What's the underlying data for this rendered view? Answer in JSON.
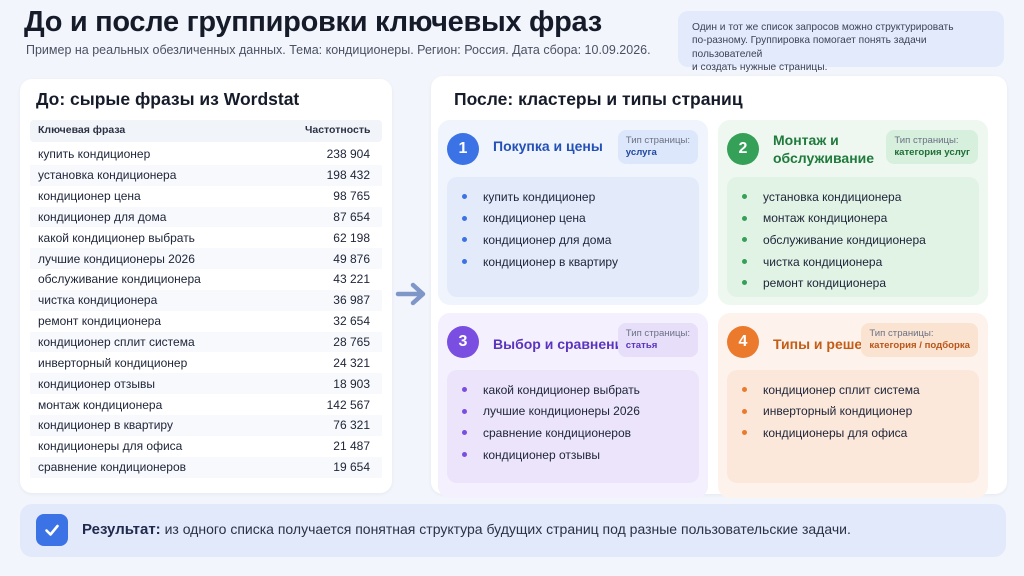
{
  "header": {
    "title": "До и после группировки ключевых фраз",
    "subtitle": "Пример на реальных обезличенных данных. Тема: кондиционеры. Регион: Россия. Дата сбора: 10.09.2026.",
    "note_lines": [
      "Один и тот же список запросов можно структурировать",
      "по-разному. Группировка помогает понять задачи пользователей",
      "и создать нужные страницы."
    ]
  },
  "before": {
    "title": "До: сырые фразы из Wordstat",
    "col_phrase": "Ключевая фраза",
    "col_freq": "Частотность",
    "rows": [
      {
        "phrase": "купить кондиционер",
        "freq": "238 904"
      },
      {
        "phrase": "установка кондиционера",
        "freq": "198 432"
      },
      {
        "phrase": "кондиционер цена",
        "freq": "98 765"
      },
      {
        "phrase": "кондиционер для дома",
        "freq": "87 654"
      },
      {
        "phrase": "какой кондиционер выбрать",
        "freq": "62 198"
      },
      {
        "phrase": "лучшие кондиционеры 2026",
        "freq": "49 876"
      },
      {
        "phrase": "обслуживание кондиционера",
        "freq": "43 221"
      },
      {
        "phrase": "чистка кондиционера",
        "freq": "36 987"
      },
      {
        "phrase": "ремонт кондиционера",
        "freq": "32 654"
      },
      {
        "phrase": "кондиционер сплит система",
        "freq": "28 765"
      },
      {
        "phrase": "инверторный кондиционер",
        "freq": "24 321"
      },
      {
        "phrase": "кондиционер отзывы",
        "freq": "18 903"
      },
      {
        "phrase": "монтаж кондиционера",
        "freq": "142 567"
      },
      {
        "phrase": "кондиционер в квартиру",
        "freq": "76 321"
      },
      {
        "phrase": "кондиционеры для офиса",
        "freq": "21 487"
      },
      {
        "phrase": "сравнение кондиционеров",
        "freq": "19 654"
      }
    ]
  },
  "after": {
    "title": "После: кластеры и типы страниц",
    "badge_label": "Тип страницы:",
    "clusters": [
      {
        "num": "1",
        "title_lines": [
          "Покупка и цены"
        ],
        "page_type": "услуга",
        "items": [
          "купить кондиционер",
          "кондиционер цена",
          "кондиционер для дома",
          "кондиционер в квартиру"
        ]
      },
      {
        "num": "2",
        "title_lines": [
          "Монтаж и",
          "обслуживание"
        ],
        "page_type": "категория услуг",
        "items": [
          "установка кондиционера",
          "монтаж кондиционера",
          "обслуживание кондиционера",
          "чистка кондиционера",
          "ремонт кондиционера"
        ]
      },
      {
        "num": "3",
        "title_lines": [
          "Выбор и сравнение"
        ],
        "page_type": "статья",
        "items": [
          "какой кондиционер выбрать",
          "лучшие кондиционеры 2026",
          "сравнение кондиционеров",
          "кондиционер отзывы"
        ]
      },
      {
        "num": "4",
        "title_lines": [
          "Типы и решения"
        ],
        "page_type": "категория / подборка",
        "items": [
          "кондиционер сплит система",
          "инверторный кондиционер",
          "кондиционеры для офиса"
        ]
      }
    ]
  },
  "result": {
    "label": "Результат:",
    "text": "из одного списка получается понятная структура будущих страниц под разные пользовательские задачи."
  },
  "icons": {
    "arrow": "arrow-right-icon",
    "check": "checkmark-icon"
  },
  "colors": {
    "blue": "#3b72e6",
    "green": "#35a057",
    "purple": "#7a4ee0",
    "orange": "#ec7a2c"
  }
}
